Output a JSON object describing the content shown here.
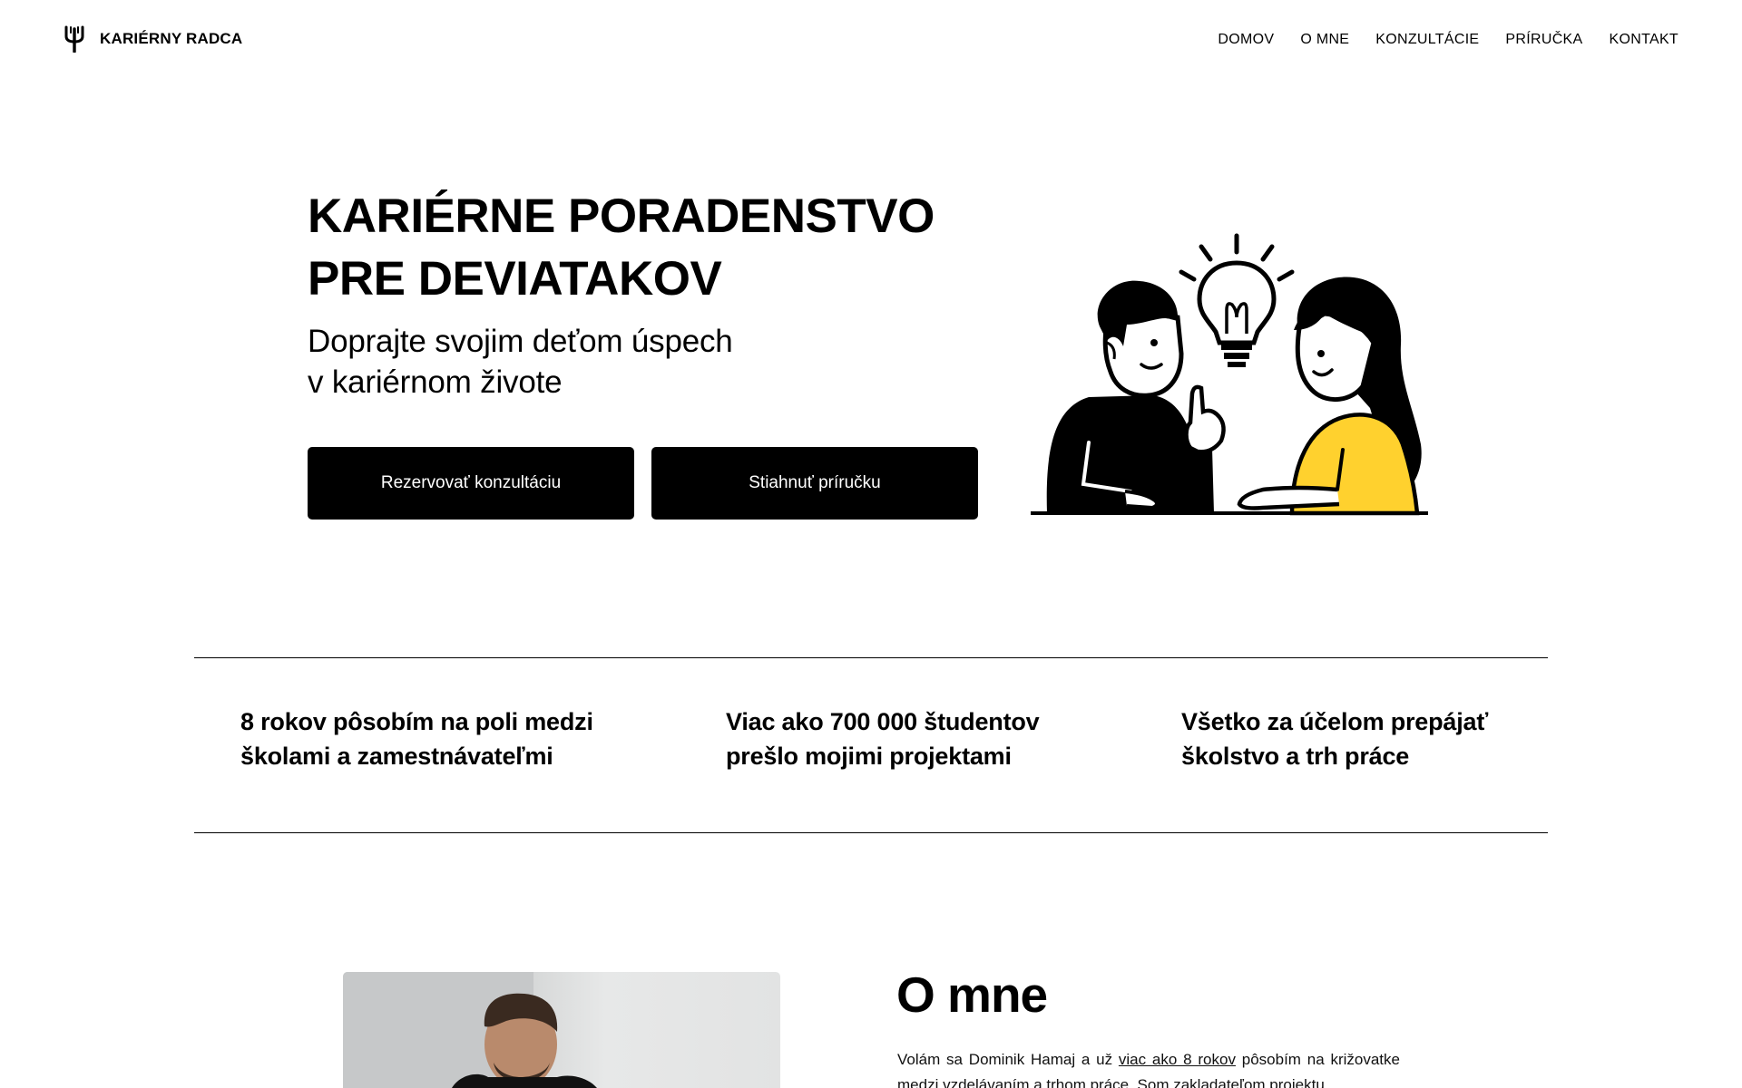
{
  "header": {
    "brand_name": "KARIÉRNY RADCA",
    "brand_icon": "fork-logo-icon",
    "nav": [
      "DOMOV",
      "O MNE",
      "KONZULTÁCIE",
      "PRÍRUČKA",
      "KONTAKT"
    ]
  },
  "hero": {
    "title_line1": "KARIÉRNE PORADENSTVO",
    "title_line2": "PRE DEVIATAKOV",
    "subtitle_line1": "Doprajte svojim deťom úspech",
    "subtitle_line2": "v kariérnom živote",
    "button_primary": "Rezervovať konzultáciu",
    "button_secondary": "Stiahnuť príručku",
    "illustration": "two-people-lightbulb-icon",
    "accent_color": "#FFD12E"
  },
  "stats": [
    {
      "line1": "8 rokov pôsobím na poli medzi",
      "line2": "školami a zamestnávateľmi"
    },
    {
      "line1": "Viac ako 700 000 študentov",
      "line2": "prešlo mojimi projektami"
    },
    {
      "line1": "Všetko za účelom prepájať",
      "line2": "školstvo a trh práce"
    }
  ],
  "about": {
    "title": "O mne",
    "text_before_link": "Volám sa Dominik Hamaj a už ",
    "link_text": "viac ako 8 rokov",
    "text_after_link": " pôsobím na križovatke medzi vzdelávaním a trhom práce. Som zakladateľom projektu"
  }
}
